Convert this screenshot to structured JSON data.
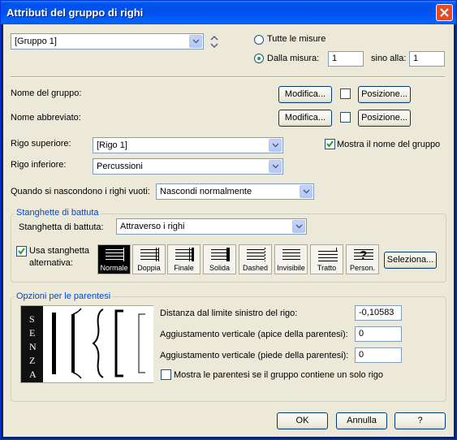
{
  "window": {
    "title": "Attributi del gruppo di righi"
  },
  "group_select": {
    "value": "[Gruppo 1]"
  },
  "measures": {
    "all_label": "Tutte le misure",
    "from_label": "Dalla misura:",
    "from_value": "1",
    "to_label": "sino alla:",
    "to_value": "1"
  },
  "group_name": {
    "label": "Nome del gruppo:",
    "edit": "Modifica...",
    "position": "Posizione..."
  },
  "short_name": {
    "label": "Nome abbreviato:",
    "edit": "Modifica...",
    "position": "Posizione..."
  },
  "top_staff": {
    "label": "Rigo superiore:",
    "value": "[Rigo 1]"
  },
  "bottom_staff": {
    "label": "Rigo inferiore:",
    "value": "Percussioni"
  },
  "show_group_name": "Mostra il nome del gruppo",
  "hide_staves": {
    "label": "Quando si nascondono i righi vuoti:",
    "value": "Nascondi normalmente"
  },
  "barlines": {
    "legend": "Stanghette di battuta",
    "label": "Stanghetta di battuta:",
    "value": "Attraverso i righi",
    "alt_label_1": "Usa stanghetta",
    "alt_label_2": "alternativa:",
    "styles": [
      "Normale",
      "Doppia",
      "Finale",
      "Solida",
      "Dashed",
      "Invisibile",
      "Tratto",
      "Person."
    ],
    "selected": "Normale",
    "select_button": "Seleziona..."
  },
  "brackets": {
    "legend": "Opzioni per le parentesi",
    "none_letters": [
      "S",
      "E",
      "N",
      "Z",
      "A"
    ],
    "distance_label": "Distanza dal limite sinistro del rigo:",
    "distance_value": "-0,10583",
    "top_adj_label": "Aggiustamento verticale (apice della parentesi):",
    "top_adj_value": "0",
    "bottom_adj_label": "Aggiustamento verticale (piede della parentesi):",
    "bottom_adj_value": "0",
    "single_label": "Mostra le parentesi se il gruppo contiene un solo rigo"
  },
  "buttons": {
    "ok": "OK",
    "cancel": "Annulla",
    "help": "?"
  }
}
